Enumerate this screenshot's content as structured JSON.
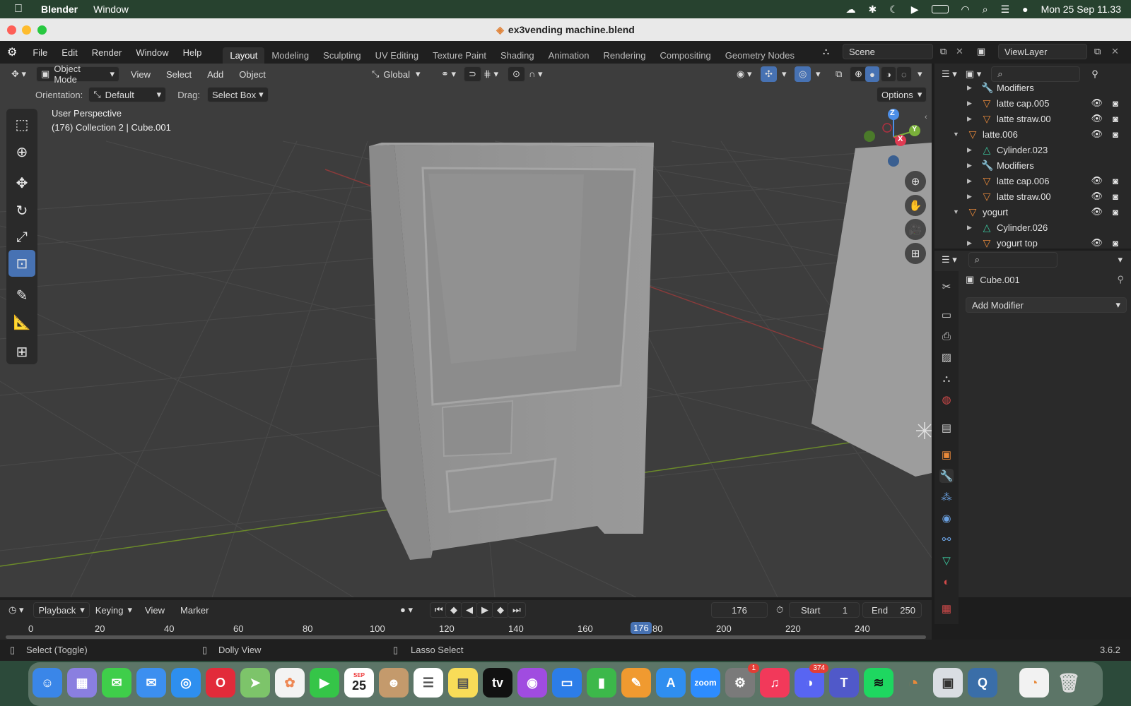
{
  "menubar": {
    "app_name": "Blender",
    "menu_window": "Window",
    "datetime": "Mon 25 Sep  11.33"
  },
  "window": {
    "title": "ex3vending machine.blend"
  },
  "blender_menu": [
    "File",
    "Edit",
    "Render",
    "Window",
    "Help"
  ],
  "workspaces": [
    "Layout",
    "Modeling",
    "Sculpting",
    "UV Editing",
    "Texture Paint",
    "Shading",
    "Animation",
    "Rendering",
    "Compositing",
    "Geometry Nodes"
  ],
  "scene": {
    "label": "Scene",
    "view_layer": "ViewLayer"
  },
  "viewport": {
    "mode": "Object Mode",
    "menus": [
      "View",
      "Select",
      "Add",
      "Object"
    ],
    "transform_orientation": "Global",
    "orientation_label": "Orientation:",
    "orientation_value": "Default",
    "drag_label": "Drag:",
    "drag_value": "Select Box",
    "options_label": "Options",
    "overlay_title": "User Perspective",
    "overlay_subtitle": "(176) Collection 2 | Cube.001",
    "gizmo": {
      "z": "Z",
      "y": "Y",
      "x": "X"
    }
  },
  "outliner": {
    "rows": [
      {
        "label": "Modifiers",
        "icon": "wrench-icon",
        "color": "#6aa0e0",
        "vis": false
      },
      {
        "label": "latte cap.005",
        "icon": "mesh-triangle-icon",
        "color": "#e8893a",
        "vis": true
      },
      {
        "label": "latte straw.00",
        "icon": "mesh-triangle-icon",
        "color": "#e8893a",
        "vis": true
      },
      {
        "label": "latte.006",
        "icon": "mesh-triangle-icon",
        "color": "#e8893a",
        "vis": true
      },
      {
        "label": "Cylinder.023",
        "icon": "mesh-data-icon",
        "color": "#3cc9a0",
        "vis": false
      },
      {
        "label": "Modifiers",
        "icon": "wrench-icon",
        "color": "#6aa0e0",
        "vis": false
      },
      {
        "label": "latte cap.006",
        "icon": "mesh-triangle-icon",
        "color": "#e8893a",
        "vis": true
      },
      {
        "label": "latte straw.00",
        "icon": "mesh-triangle-icon",
        "color": "#e8893a",
        "vis": true
      },
      {
        "label": "yogurt",
        "icon": "mesh-triangle-icon",
        "color": "#e8893a",
        "vis": true
      },
      {
        "label": "Cylinder.026",
        "icon": "mesh-data-icon",
        "color": "#3cc9a0",
        "vis": false
      },
      {
        "label": "yogurt top",
        "icon": "mesh-triangle-icon",
        "color": "#e8893a",
        "vis": true
      }
    ]
  },
  "properties": {
    "object_name": "Cube.001",
    "add_modifier": "Add Modifier"
  },
  "timeline": {
    "menus": [
      "Playback",
      "Keying",
      "View",
      "Marker"
    ],
    "current_frame": "176",
    "start_label": "Start",
    "start_value": "1",
    "end_label": "End",
    "end_value": "250",
    "ruler": [
      "0",
      "20",
      "40",
      "60",
      "80",
      "100",
      "120",
      "140",
      "160",
      "176",
      "80",
      "200",
      "220",
      "240"
    ]
  },
  "statusbar": {
    "left": "Select (Toggle)",
    "middle": "Dolly View",
    "right": "Lasso Select",
    "version": "3.6.2"
  },
  "dock": {
    "calendar_month": "SEP",
    "calendar_day": "25",
    "settings_badge": "1",
    "discord_badge": "374",
    "zoom_label": "zoom",
    "tv_label": "tv"
  }
}
